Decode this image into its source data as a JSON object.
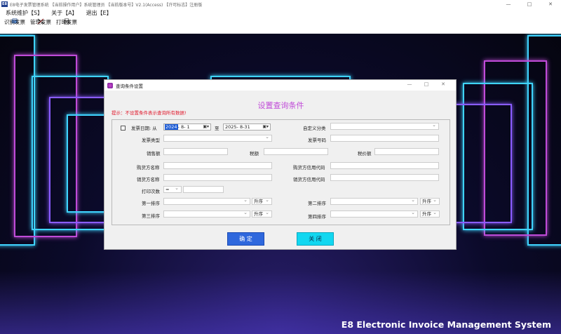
{
  "window": {
    "icon_text": "E8",
    "title": "E8电子发票管理系统   【当前操作用户】系统管理员   【当前版本号】V2.1(Access)   【许可标志】注册版",
    "minimize": "—",
    "maximize": "□",
    "close": "✕"
  },
  "menu": [
    "系统维护【S】",
    "关于【A】",
    "退出【E】"
  ],
  "toolbar": [
    "识别发票",
    "管理发票",
    "打印发票"
  ],
  "background": {
    "system_name": "E8 Electronic Invoice Management System"
  },
  "dialog": {
    "title": "查询条件设置",
    "heading": "设置查询条件",
    "hint": "提示：不设置条件表示查询所有数据!",
    "controls": {
      "minimize": "—",
      "maximize": "□",
      "close": "✕"
    },
    "date_label": "发票日期: 从",
    "date_from_year": "2024",
    "date_from_rest": "- 8- 1",
    "date_to_label": "至",
    "date_to": "2025- 8-31",
    "custom_category_label": "自定义分类",
    "invoice_type_label": "发票类型",
    "invoice_no_label": "发票号码",
    "sales_amount_label": "销售额",
    "tax_amount_label": "税额",
    "total_label": "税价额",
    "buyer_name_label": "购货方名称",
    "buyer_credit_label": "购货方信用代码",
    "seller_name_label": "销货方名称",
    "seller_credit_label": "销货方信用代码",
    "print_count_label": "打印次数",
    "print_operator": "=",
    "sort1_label": "第一排序",
    "sort2_label": "第二排序",
    "sort3_label": "第三排序",
    "sort4_label": "第四排序",
    "order_asc": "升序",
    "ok_button": "确  定",
    "close_button": "关  闭"
  }
}
